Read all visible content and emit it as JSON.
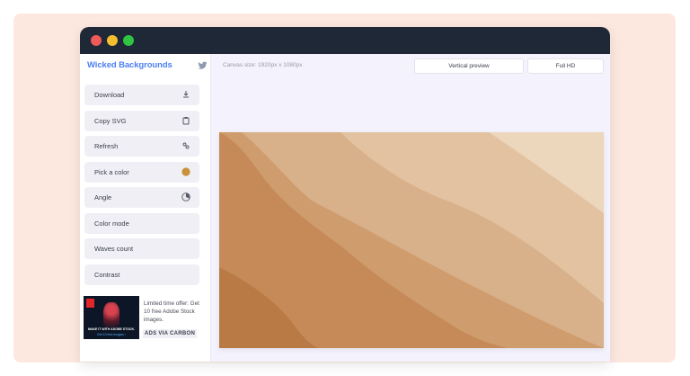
{
  "app": {
    "brand": "Wicked Backgrounds",
    "canvas_size": "Canvas size: 1920px x 1080px"
  },
  "toolbar": {
    "vertical_preview": "Vertical preview",
    "resolution": "Full HD"
  },
  "sidebar": {
    "items": [
      {
        "label": "Download",
        "icon": "download-icon"
      },
      {
        "label": "Copy SVG",
        "icon": "clipboard-icon"
      },
      {
        "label": "Refresh",
        "icon": "shuffle-icon"
      },
      {
        "label": "Pick a color",
        "icon": "color-swatch-icon"
      },
      {
        "label": "Angle",
        "icon": "angle-icon"
      },
      {
        "label": "Color mode",
        "icon": ""
      },
      {
        "label": "Waves count",
        "icon": ""
      },
      {
        "label": "Contrast",
        "icon": ""
      }
    ]
  },
  "ad": {
    "text": "Limited time offer: Get 10 free Adobe Stock images.",
    "badge": "ADS VIA CARBON",
    "image_line1": "MAKE IT WITH ADOBE STOCK.",
    "image_line2": "Get 10 free images ›"
  },
  "colors": {
    "picked": "#c9923a",
    "accent": "#4d7ff0",
    "waves": [
      "#ecd7bc",
      "#e2c2a0",
      "#d8b08a",
      "#cf9c6e",
      "#c58a58",
      "#b97a45"
    ]
  }
}
